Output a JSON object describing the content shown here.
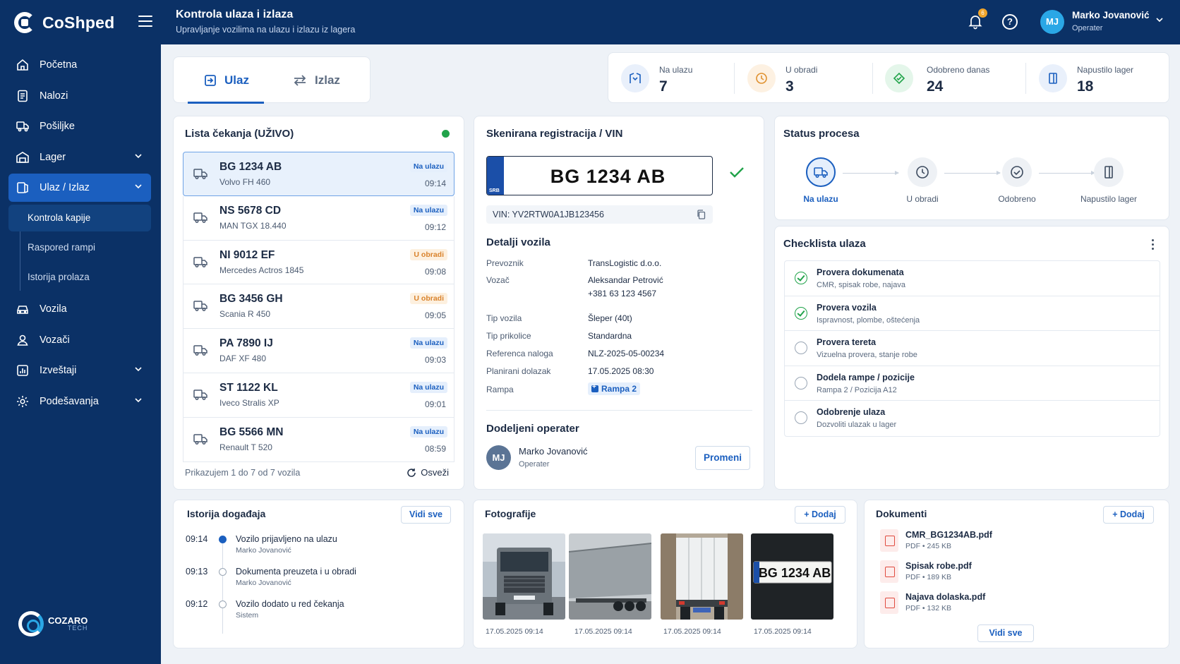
{
  "app": {
    "name": "CoShped",
    "footer_brand": "COZARO",
    "footer_brand_sub": "TECH"
  },
  "sidebar": {
    "items": [
      {
        "label": "Početna",
        "icon": "home-icon"
      },
      {
        "label": "Nalozi",
        "icon": "document-icon"
      },
      {
        "label": "Pošiljke",
        "icon": "package-truck-icon"
      },
      {
        "label": "Lager",
        "icon": "warehouse-icon",
        "has_chevron": true
      },
      {
        "label": "Ulaz / Izlaz",
        "icon": "gate-icon",
        "has_chevron": true,
        "active": true
      },
      {
        "label": "Vozila",
        "icon": "car-icon"
      },
      {
        "label": "Vozači",
        "icon": "user-icon"
      },
      {
        "label": "Izveštaji",
        "icon": "chart-icon",
        "has_chevron": true
      },
      {
        "label": "Podešavanja",
        "icon": "gear-icon",
        "has_chevron": true
      }
    ],
    "subitems": [
      {
        "label": "Kontrola kapije",
        "active": true
      },
      {
        "label": "Raspored rampi"
      },
      {
        "label": "Istorija prolaza"
      }
    ]
  },
  "header": {
    "title": "Kontrola ulaza i izlaza",
    "subtitle": "Upravljanje vozilima na ulazu i izlazu iz lagera",
    "notification_count": "6",
    "user": {
      "initials": "MJ",
      "name": "Marko Jovanović",
      "role": "Operater"
    }
  },
  "tabs": [
    {
      "label": "Ulaz",
      "active": true
    },
    {
      "label": "Izlaz"
    }
  ],
  "stats": [
    {
      "label": "Na ulazu",
      "value": "7",
      "color": "#1b5fbf",
      "bg": "#e9f0fb"
    },
    {
      "label": "U obradi",
      "value": "3",
      "color": "#e0912f",
      "bg": "#fdf1e2"
    },
    {
      "label": "Odobreno danas",
      "value": "24",
      "color": "#21a34a",
      "bg": "#e4f6ea"
    },
    {
      "label": "Napustilo lager",
      "value": "18",
      "color": "#1b5fbf",
      "bg": "#e9f0fb"
    }
  ],
  "queue": {
    "title": "Lista čekanja (UŽIVO)",
    "items": [
      {
        "plate": "BG 1234 AB",
        "model": "Volvo FH 460",
        "status": "Na ulazu",
        "status_color": "blue",
        "time": "09:14",
        "selected": true
      },
      {
        "plate": "NS 5678 CD",
        "model": "MAN TGX 18.440",
        "status": "Na ulazu",
        "status_color": "blue",
        "time": "09:12"
      },
      {
        "plate": "NI 9012 EF",
        "model": "Mercedes Actros 1845",
        "status": "U obradi",
        "status_color": "orange",
        "time": "09:08"
      },
      {
        "plate": "BG 3456 GH",
        "model": "Scania R 450",
        "status": "U obradi",
        "status_color": "orange",
        "time": "09:05"
      },
      {
        "plate": "PA 7890 IJ",
        "model": "DAF XF 480",
        "status": "Na ulazu",
        "status_color": "blue",
        "time": "09:03"
      },
      {
        "plate": "ST 1122 KL",
        "model": "Iveco Stralis XP",
        "status": "Na ulazu",
        "status_color": "blue",
        "time": "09:01"
      },
      {
        "plate": "BG 5566 MN",
        "model": "Renault T 520",
        "status": "Na ulazu",
        "status_color": "blue",
        "time": "08:59"
      }
    ],
    "footer": "Prikazujem 1 do 7 od 7 vozila",
    "refresh_label": "Osveži"
  },
  "vehicle": {
    "title": "Skenirana registracija / VIN",
    "plate": "BG 1234 AB",
    "country": "SRB",
    "vin": "VIN: YV2RTW0A1JB123456",
    "details_title": "Detalji vozila",
    "details": [
      {
        "label": "Prevoznik",
        "value": "TransLogistic d.o.o."
      },
      {
        "label": "Vozač",
        "value": "Aleksandar Petrović",
        "value2": "+381 63 123 4567"
      },
      {
        "label": "Tip vozila",
        "value": "Šleper (40t)"
      },
      {
        "label": "Tip prikolice",
        "value": "Standardna"
      },
      {
        "label": "Referenca naloga",
        "value": "NLZ-2025-05-00234"
      },
      {
        "label": "Planirani dolazak",
        "value": "17.05.2025 08:30"
      },
      {
        "label": "Rampa",
        "value": "Rampa 2",
        "pill": true
      }
    ],
    "operator_title": "Dodeljeni operater",
    "operator": {
      "initials": "MJ",
      "name": "Marko Jovanović",
      "role": "Operater"
    },
    "change_label": "Promeni"
  },
  "process": {
    "title": "Status procesa",
    "steps": [
      {
        "label": "Na ulazu",
        "icon": "truck-icon",
        "active": true
      },
      {
        "label": "U obradi",
        "icon": "clock-icon"
      },
      {
        "label": "Odobreno",
        "icon": "check-circle-icon"
      },
      {
        "label": "Napustilo lager",
        "icon": "exit-door-icon"
      }
    ]
  },
  "checklist": {
    "title": "Checklista ulaza",
    "items": [
      {
        "title": "Provera dokumenata",
        "sub": "CMR, spisak robe, najava",
        "done": true
      },
      {
        "title": "Provera vozila",
        "sub": "Ispravnost, plombe, oštećenja",
        "done": true
      },
      {
        "title": "Provera tereta",
        "sub": "Vizuelna provera, stanje robe",
        "done": false
      },
      {
        "title": "Dodela rampe / pozicije",
        "sub": "Rampa 2 / Pozicija A12",
        "done": false
      },
      {
        "title": "Odobrenje ulaza",
        "sub": "Dozvoliti ulazak u lager",
        "done": false
      }
    ]
  },
  "history": {
    "title": "Istorija događaja",
    "see_all": "Vidi sve",
    "events": [
      {
        "time": "09:14",
        "title": "Vozilo prijavljeno na ulazu",
        "by": "Marko Jovanović",
        "active": true
      },
      {
        "time": "09:13",
        "title": "Dokumenta preuzeta i u obradi",
        "by": "Marko Jovanović"
      },
      {
        "time": "09:12",
        "title": "Vozilo dodato u red čekanja",
        "by": "Sistem"
      }
    ]
  },
  "photos": {
    "title": "Fotografije",
    "add_label": "+ Dodaj",
    "items": [
      {
        "date": "17.05.2025 09:14",
        "kind": "truck-front"
      },
      {
        "date": "17.05.2025 09:14",
        "kind": "trailer-side"
      },
      {
        "date": "17.05.2025 09:14",
        "kind": "trailer-rear"
      },
      {
        "date": "17.05.2025 09:14",
        "kind": "plate",
        "plate_text": "BG 1234 AB"
      }
    ]
  },
  "documents": {
    "title": "Dokumenti",
    "add_label": "+ Dodaj",
    "see_all": "Vidi sve",
    "items": [
      {
        "name": "CMR_BG1234AB.pdf",
        "meta": "PDF • 245 KB"
      },
      {
        "name": "Spisak robe.pdf",
        "meta": "PDF • 189 KB"
      },
      {
        "name": "Najava dolaska.pdf",
        "meta": "PDF • 132 KB"
      }
    ]
  }
}
